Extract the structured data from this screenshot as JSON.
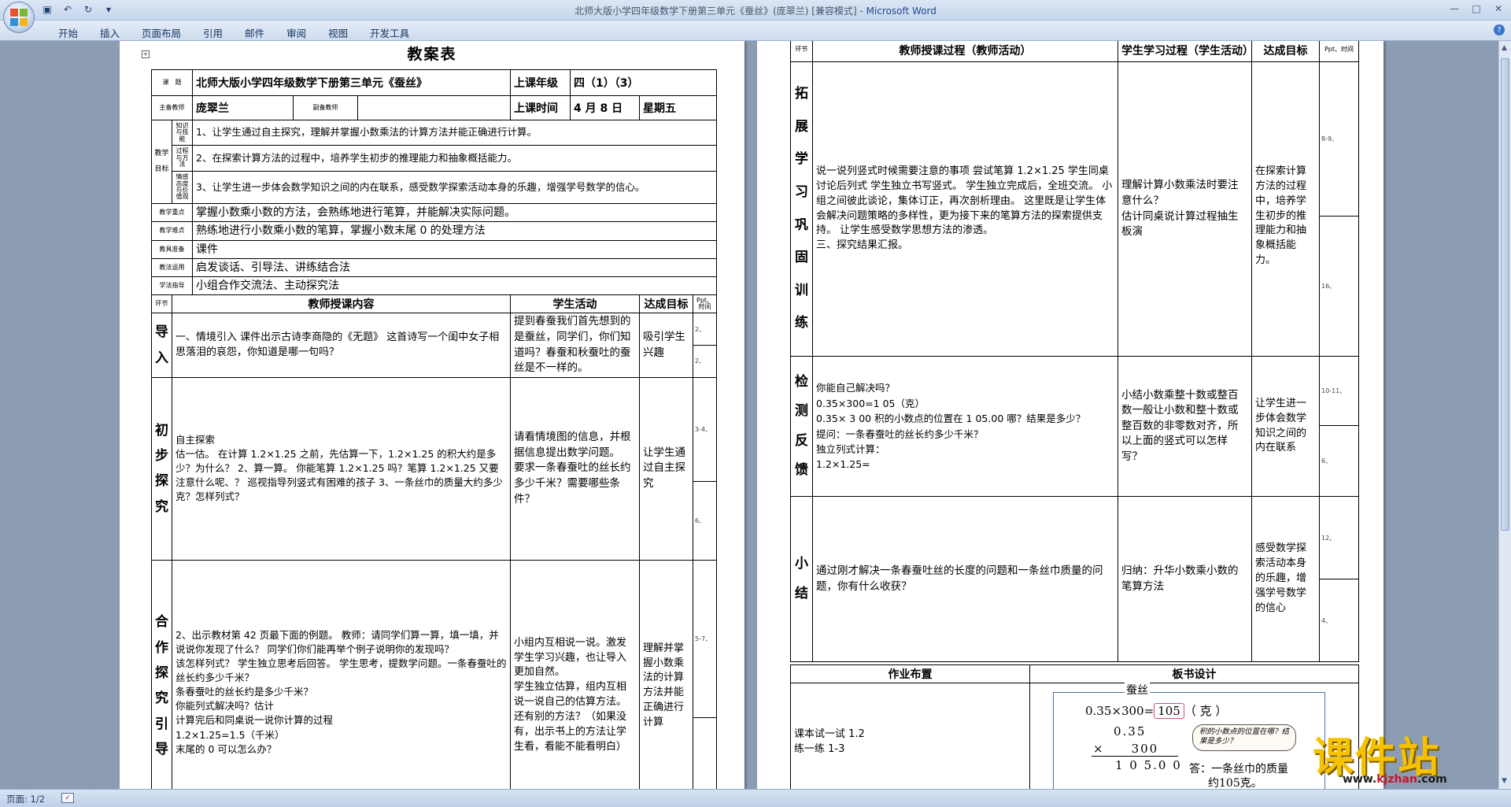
{
  "window": {
    "title_doc": "北师大版小学四年级数学下册第三单元《蚕丝》(庞翠兰) [兼容模式] - ",
    "title_app": "Microsoft Word"
  },
  "ribbon": {
    "tabs": [
      "开始",
      "插入",
      "页面布局",
      "引用",
      "邮件",
      "审阅",
      "视图",
      "开发工具"
    ]
  },
  "status": {
    "page": "页面: 1/2"
  },
  "page1": {
    "heading": "教案表",
    "topic_label": "课　题",
    "topic": "北师大版小学四年级数学下册第三单元《蚕丝》",
    "grade_label": "上课年级",
    "grade": "四（1）（3）",
    "teacher_label": "主备教师",
    "teacher": "庞翠兰",
    "assist_label": "副备教师",
    "time_label": "上课时间",
    "date": "4 月 8 日",
    "weekday": "星期五",
    "goals_label": "教学目标",
    "goal_types": [
      "知识与技能",
      "过程与方法",
      "情感态度与价值观"
    ],
    "goals": [
      "1、让学生通过自主探究，理解并掌握小数乘法的计算方法并能正确进行计算。",
      "2、在探索计算方法的过程中，培养学生初步的推理能力和抽象概括能力。",
      "3、让学生进一步体会数学知识之间的内在联系，感受数学探索活动本身的乐趣，增强学号数学的信心。"
    ],
    "rows": [
      {
        "label": "教学重点",
        "text": "掌握小数乘小数的方法，会熟练地进行笔算，并能解决实际问题。"
      },
      {
        "label": "教学难点",
        "text": "熟练地进行小数乘小数的笔算，掌握小数末尾 0 的处理方法"
      },
      {
        "label": "教具准备",
        "text": "课件"
      },
      {
        "label": "教法运用",
        "text": "启发谈话、引导法、讲练结合法"
      },
      {
        "label": "学法指导",
        "text": "小组合作交流法、主动探究法"
      }
    ],
    "col_headers": {
      "stage": "环节",
      "content": "教师授课内容",
      "student": "学生活动",
      "goal": "达成目标",
      "time": "Ppt、时间"
    },
    "sections": [
      {
        "stage": "导入",
        "content": "一、情境引入 课件出示古诗李商隐的《无题》 这首诗写一个闺中女子相思落泪的哀怨，你知道是哪一句吗？",
        "student": "提到春蚕我们首先想到的是蚕丝，同学们，你们知道吗？春蚕和秋蚕吐的蚕丝是不一样的。",
        "goal": "吸引学生兴趣",
        "times": [
          "2、",
          "2、"
        ]
      },
      {
        "stage": "初步探究",
        "content": "自主探索\n估一估。 在计算 1.2×1.25 之前，先估算一下，1.2×1.25 的积大约是多少？为什么？ 2、算一算。 你能笔算 1.2×1.25 吗？笔算 1.2×1.25 又要注意什么呢、？ 巡视指导列竖式有困难的孩子 3、一条丝巾的质量大约多少克？怎样列式？",
        "student": "请看情境图的信息，并根据信息提出数学问题。\n要求一条春蚕吐的丝长约多少千米？需要哪些条件？",
        "goal": "让学生通过自主探究",
        "times": [
          "3-4、",
          "6、"
        ]
      },
      {
        "stage": "合作探究引导",
        "content": "2、出示教材第 42 页最下面的例题。 教师：请同学们算一算，填一填，并说说你发现了什么？ 同学们你们能再举个例子说明你的发现吗？\n该怎样列式？ 学生独立思考后回答。 学生思考，提数学问题。一条春蚕吐的丝长约多少千米？\n条春蚕吐的丝长约是多少千米？\n你能列式解决吗？估计\n计算完后和同桌说一说你计算的过程\n1.2×1.25=1.5（千米）\n末尾的 0 可以怎么办？",
        "student": "小组内互相说一说。激发学生学习兴趣，也让导入更加自然。\n学生独立估算，组内互相说一说自己的估算方法。还有别的方法？（如果没有，出示书上的方法让学生看，看能不能看明白）",
        "goal": "理解并掌握小数乘法的计算方法并能正确进行计算",
        "times": [
          "5-7、",
          ""
        ]
      }
    ]
  },
  "page2": {
    "col_headers": {
      "stage": "环节",
      "content": "教师授课过程（教师活动）",
      "student": "学生学习过程（学生活动）",
      "goal": "达成目标",
      "time": "Ppt、时间"
    },
    "sections": [
      {
        "stage": "拓展学习巩固训练",
        "content": "说一说列竖式时候需要注意的事项 尝试笔算 1.2×1.25 学生同桌讨论后列式 学生独立书写竖式。 学生独立完成后，全班交流。 小组之间彼此谈论，集体订正，再次剖析理由。 这里既是让学生体会解决问题策略的多样性，更为接下来的笔算方法的探索提供支持。 让学生感受数学思想方法的渗透。\n三、探究结果汇报。",
        "student": "理解计算小数乘法时要注意什么？\n估计同桌说计算过程抽生板演",
        "goal": "在探索计算方法的过程中，培养学生初步的推理能力和抽象概括能力。",
        "times": [
          "8-9、",
          "16、"
        ]
      },
      {
        "stage": "检测反馈",
        "content": "你能自己解决吗？\n0.35×300=1 05（克）\n0.35× 3 00 积的小数点的位置在 1 05.00 哪？结果是多少？\n提问：一条春蚕吐的丝长约多少千米？\n独立列式计算：\n1.2×1.25=",
        "student": "小结小数乘整十数或整百数一般让小数和整十数或整百数的非零数对齐，所以上面的竖式可以怎样写？",
        "goal": "让学生进一步体会数学知识之间的内在联系",
        "times": [
          "10-11、",
          "6、"
        ]
      },
      {
        "stage": "小结",
        "content": "通过刚才解决一条春蚕吐丝的长度的问题和一条丝巾质量的问题，你有什么收获？",
        "student": "归纳：升华小数乘小数的笔算方法",
        "goal": "感受数学探索活动本身的乐趣，增强学号数学的信心",
        "times": [
          "12、",
          "4、"
        ]
      }
    ],
    "homework_label": "作业布置",
    "board_label": "板书设计",
    "homework": [
      "课本试一试 1.2",
      "练一练 1-3"
    ],
    "board": {
      "title": "蚕丝",
      "line1_left": "0.35×300=",
      "line1_box": "105",
      "line1_unit": "（ 克 ）",
      "calc_top": "0.35",
      "calc_mid": "×　　300",
      "calc_result": "1 0 5.0 0",
      "bubble": "积的小数点的位置在哪？结果是多少？",
      "answer1": "答：一条丝巾的质量",
      "answer2": "约105克。"
    }
  },
  "watermark": {
    "cn": "课件站",
    "url_prefix": "www.",
    "url_main": "kjzhan",
    "url_suffix": ".com"
  },
  "colors": {
    "ribbon": "#cfdcef",
    "doc_bg": "#8c9cb3",
    "watermark": "#f6c200"
  }
}
